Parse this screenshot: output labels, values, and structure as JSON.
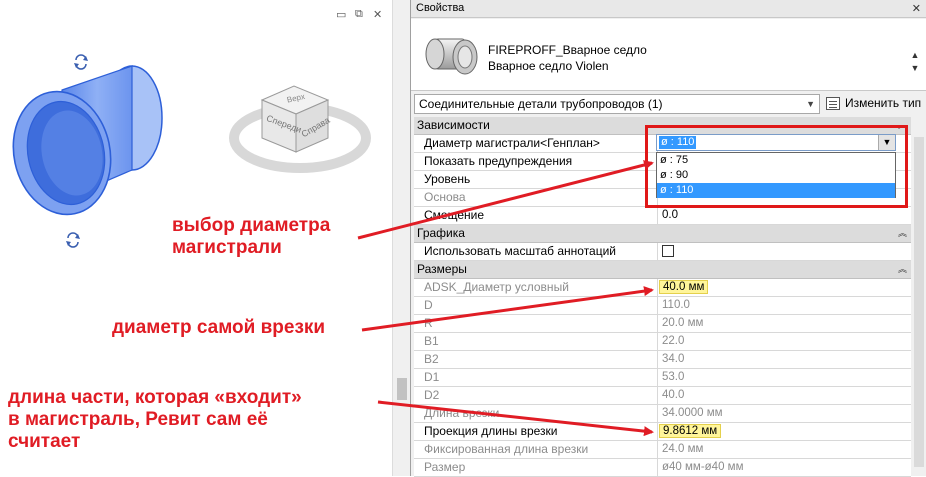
{
  "panel": {
    "title": "Свойства",
    "close_icon": "close-icon"
  },
  "type": {
    "family": "FIREPROFF_Вварное седло",
    "name": "Вварное седло Violen"
  },
  "filter": {
    "value": "Соединительные детали трубопроводов (1)",
    "edit_type": "Изменить тип"
  },
  "groups": {
    "constraints": "Зависимости",
    "graphics": "Графика",
    "dimensions": "Размеры"
  },
  "rows": {
    "main_diameter": {
      "label": "Диаметр магистрали<Генплан>",
      "value": "ø : 110"
    },
    "show_warnings": {
      "label": "Показать предупреждения"
    },
    "level": {
      "label": "Уровень"
    },
    "host": {
      "label": "Основа"
    },
    "offset": {
      "label": "Смещение",
      "value": "0.0"
    },
    "annotation_scale": {
      "label": "Использовать масштаб аннотаций",
      "checked": false
    },
    "nominal_diameter": {
      "label": "ADSK_Диаметр условный",
      "value": "40.0 мм"
    },
    "d": {
      "label": "D",
      "value": "110.0"
    },
    "r": {
      "label": "R",
      "value": "20.0 мм"
    },
    "b1": {
      "label": "B1",
      "value": "22.0"
    },
    "b2": {
      "label": "B2",
      "value": "34.0"
    },
    "d1": {
      "label": "D1",
      "value": "53.0"
    },
    "d2": {
      "label": "D2",
      "value": "40.0"
    },
    "branch_length": {
      "label": "Длина врезки",
      "value": "34.0000 мм"
    },
    "branch_projection": {
      "label": "Проекция длины врезки",
      "value": "9.8612 мм"
    },
    "fixed_length": {
      "label": "Фиксированная длина врезки",
      "value": "24.0 мм"
    },
    "size": {
      "label": "Размер",
      "value": "ø40 мм-ø40 мм"
    }
  },
  "dropdown": {
    "selected": "ø : 110",
    "options": [
      "ø : 75",
      "ø : 90",
      "ø : 110"
    ]
  },
  "viewcube": {
    "top": "Верх",
    "front": "Спереди",
    "right": "Справа"
  },
  "annotations": {
    "main_diameter_note": "выбор диаметра\nмагистрали",
    "branch_diameter_note": "диаметр самой врезки",
    "length_note": "длина части, которая «входит»\nв магистраль, Ревит сам её\nсчитает"
  },
  "colors": {
    "annotation_red": "#e01c24",
    "highlight_yellow": "#fff59a",
    "selection_blue": "#3399ff",
    "part_blue": "#2d5fd8"
  }
}
